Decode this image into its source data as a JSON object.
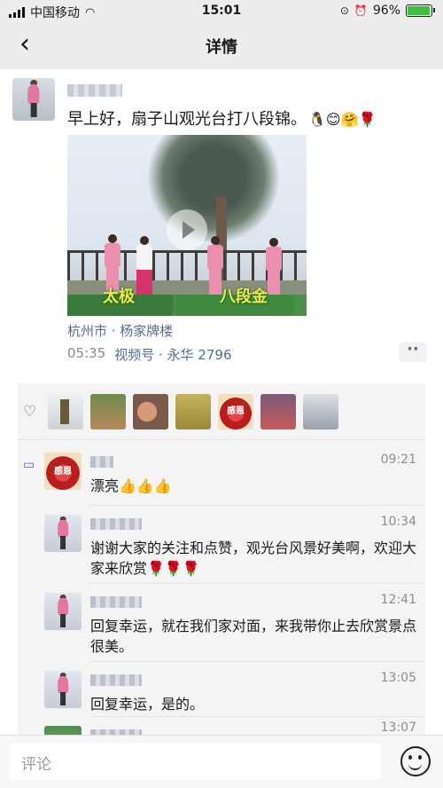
{
  "status_bar": {
    "carrier": "中国移动",
    "time": "15:01",
    "battery": "96%",
    "battery_level": 0.96
  },
  "nav": {
    "back_icon": "chevron-left-icon",
    "title": "详情"
  },
  "post": {
    "text": "早上好，扇子山观光台打八段锦。",
    "emojis": "🐧😊🤗🌹",
    "video_captions": [
      "太极",
      "八段金"
    ],
    "location": "杭州市 · 杨家牌楼",
    "time": "05:35",
    "channel": "视频号 · 永华 2796",
    "more_label": "··"
  },
  "likes": {
    "icon": "heart-outline-icon",
    "count": 7
  },
  "comments": [
    {
      "time": "09:21",
      "text": "漂亮👍👍👍"
    },
    {
      "time": "10:34",
      "text": "谢谢大家的关注和点赞，观光台风景好美啊，欢迎大家来欣赏🌹🌹🌹"
    },
    {
      "time": "12:41",
      "text": "回复幸运，就在我们家对面，来我带你止去欣赏景点很美。"
    },
    {
      "time": "13:05",
      "text": "回复幸运，是的。"
    },
    {
      "time": "13:07",
      "text": ""
    }
  ],
  "comment_input": {
    "placeholder": "评论",
    "emoji_icon": "smiley-face-icon"
  },
  "colors": {
    "link_blue": "#576b95",
    "header_bg": "#ededed",
    "comment_bg": "#f4f4f4"
  }
}
